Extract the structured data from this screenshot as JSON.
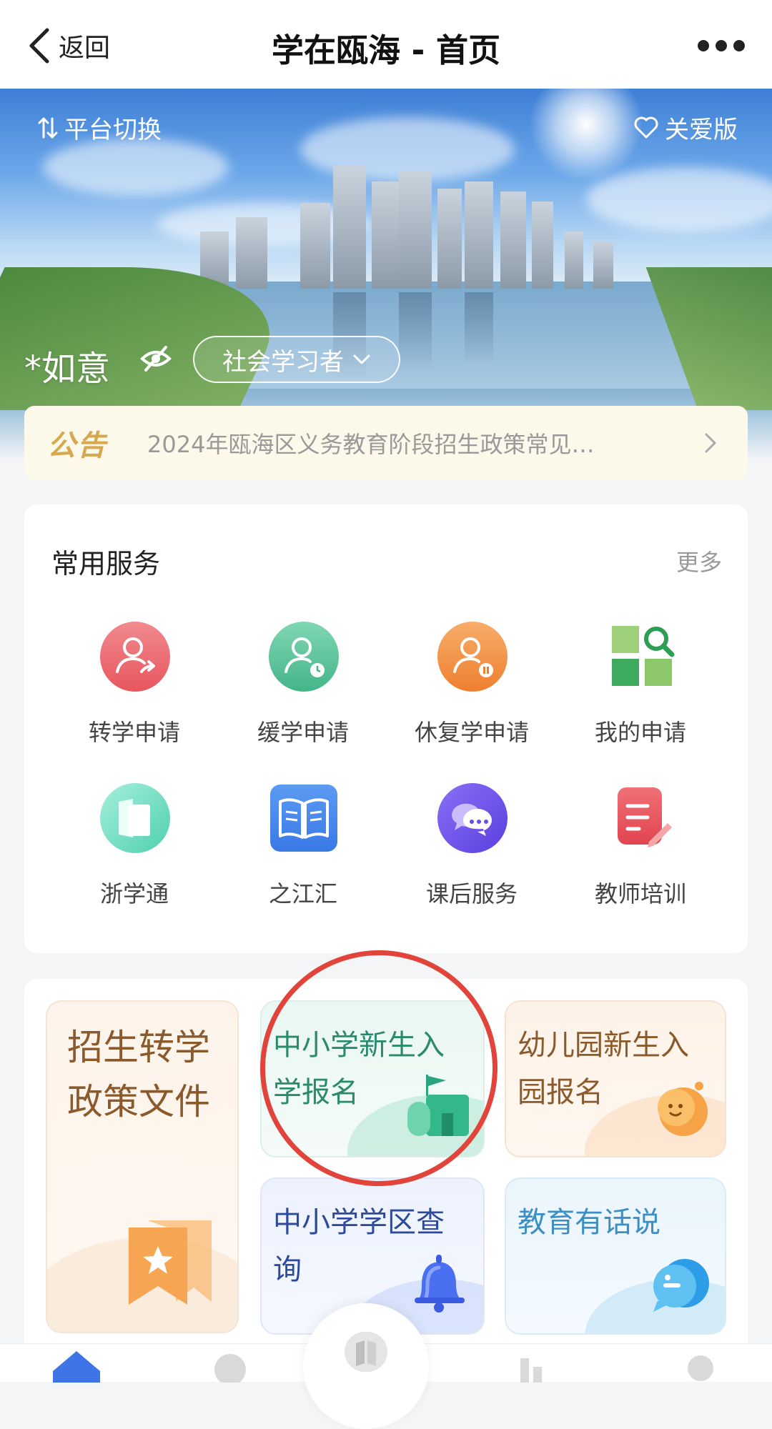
{
  "header": {
    "back_label": "返回",
    "title": "学在瓯海 - 首页"
  },
  "banner": {
    "switch_label": "平台切换",
    "care_label": "关爱版",
    "user_name": "*如意",
    "role_label": "社会学习者"
  },
  "notice": {
    "tag": "公告",
    "text": "2024年瓯海区义务教育阶段招生政策常见…"
  },
  "services": {
    "title": "常用服务",
    "more_label": "更多",
    "items": [
      {
        "label": "转学申请",
        "icon": "user-transfer-icon",
        "color": "#e8565d"
      },
      {
        "label": "缓学申请",
        "icon": "user-clock-icon",
        "color": "#4dbd92"
      },
      {
        "label": "休复学申请",
        "icon": "user-pause-icon",
        "color": "#f08a3b"
      },
      {
        "label": "我的申请",
        "icon": "grid-search-icon",
        "color": "#3daa5e"
      },
      {
        "label": "浙学通",
        "icon": "zhexuetong-icon",
        "color": "#5ed6b7"
      },
      {
        "label": "之江汇",
        "icon": "book-icon",
        "color": "#3f7ee8"
      },
      {
        "label": "课后服务",
        "icon": "chat-bubbles-icon",
        "color": "#6a4de8"
      },
      {
        "label": "教师培训",
        "icon": "note-pencil-icon",
        "color": "#e84f55"
      }
    ]
  },
  "cards": [
    {
      "label_lines": [
        "招生转学",
        "政策文件"
      ],
      "icon": "star-bookmark-icon"
    },
    {
      "label_lines": [
        "中小学新生入",
        "学报名"
      ],
      "icon": "school-building-icon"
    },
    {
      "label_lines": [
        "幼儿园新生入",
        "园报名"
      ],
      "icon": "smiley-face-icon"
    },
    {
      "label_lines": [
        "中小学学区查",
        "询"
      ],
      "icon": "bell-icon"
    },
    {
      "label_lines": [
        "教育有话说"
      ],
      "icon": "speech-bubble-icon"
    }
  ]
}
